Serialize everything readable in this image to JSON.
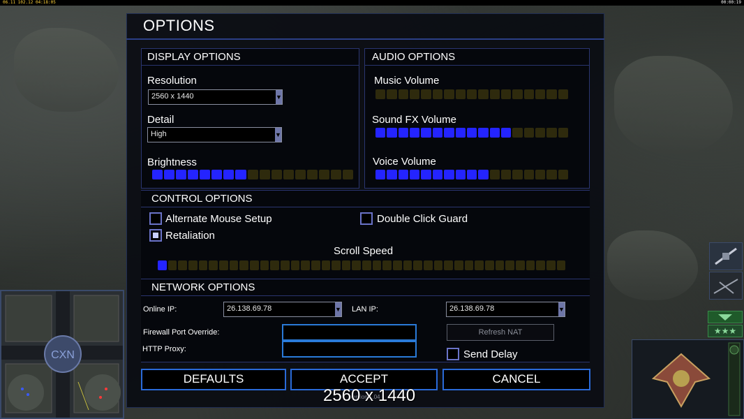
{
  "topbar": {
    "left_text": "06.11 102.12 04:18:05",
    "right_text": "00:00:19"
  },
  "dialog": {
    "title": "OPTIONS",
    "display": {
      "header": "DISPLAY OPTIONS",
      "resolution_label": "Resolution",
      "resolution_value": "2560 x 1440",
      "detail_label": "Detail",
      "detail_value": "High",
      "brightness_label": "Brightness",
      "brightness_level": 8,
      "brightness_max": 17
    },
    "audio": {
      "header": "AUDIO OPTIONS",
      "music_label": "Music Volume",
      "music_level": 0,
      "music_max": 17,
      "sfx_label": "Sound FX Volume",
      "sfx_level": 12,
      "sfx_max": 17,
      "voice_label": "Voice Volume",
      "voice_level": 10,
      "voice_max": 17
    },
    "control": {
      "header": "CONTROL OPTIONS",
      "alt_mouse_label": "Alternate Mouse Setup",
      "alt_mouse_checked": false,
      "double_click_label": "Double Click Guard",
      "double_click_checked": false,
      "retaliation_label": "Retaliation",
      "retaliation_checked": true,
      "scroll_speed_label": "Scroll Speed",
      "scroll_level": 1,
      "scroll_max": 40
    },
    "network": {
      "header": "NETWORK OPTIONS",
      "online_ip_label": "Online IP:",
      "online_ip_value": "26.138.69.78",
      "lan_ip_label": "LAN IP:",
      "lan_ip_value": "26.138.69.78",
      "firewall_label": "Firewall Port Override:",
      "firewall_value": "",
      "http_proxy_label": "HTTP Proxy:",
      "http_proxy_value": "",
      "refresh_nat_label": "Refresh NAT",
      "send_delay_label": "Send Delay",
      "send_delay_checked": false
    },
    "buttons": {
      "defaults": "DEFAULTS",
      "accept": "ACCEPT",
      "cancel": "CANCEL"
    },
    "version_text": "Version 1.04"
  },
  "overlay_resolution": "2560 x 1440",
  "colors": {
    "accent_blue": "#2424ff",
    "slider_off": "#2e2a0d",
    "border_blue": "#2a6ad8"
  }
}
